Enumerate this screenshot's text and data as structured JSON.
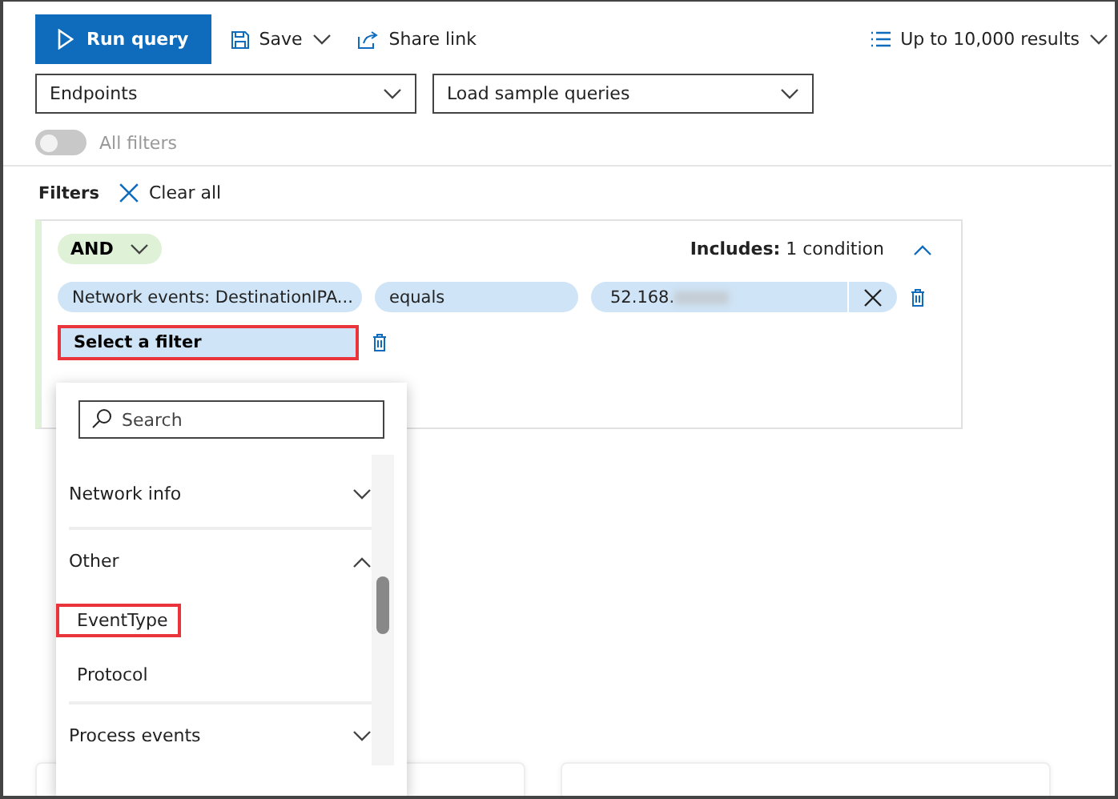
{
  "toolbar": {
    "run": "Run query",
    "save": "Save",
    "share": "Share link",
    "results": "Up to 10,000 results"
  },
  "selects": [
    {
      "value": "Endpoints"
    },
    {
      "value": "Load sample queries"
    }
  ],
  "all_filters": {
    "label": "All filters",
    "on": false,
    "disabled": true
  },
  "filters": {
    "title": "Filters",
    "clear": "Clear all"
  },
  "group": {
    "operator": "AND",
    "includes_label": "Includes:",
    "includes_value": "1 condition",
    "expanded": true,
    "conditions": [
      {
        "field": "Network events: DestinationIPA...",
        "operator": "equals",
        "value": "52.168."
      }
    ],
    "new_filter": {
      "label": "Select a filter",
      "highlighted": true
    }
  },
  "dropdown": {
    "search": {
      "placeholder": "Search"
    },
    "items": [
      {
        "kind": "group",
        "label": "Network info",
        "expanded": false
      },
      {
        "kind": "group",
        "label": "Other",
        "expanded": true
      },
      {
        "kind": "field",
        "label": "EventType",
        "highlighted": true
      },
      {
        "kind": "field",
        "label": "Protocol",
        "highlighted": false
      },
      {
        "kind": "group",
        "label": "Process events",
        "expanded": false
      }
    ]
  }
}
